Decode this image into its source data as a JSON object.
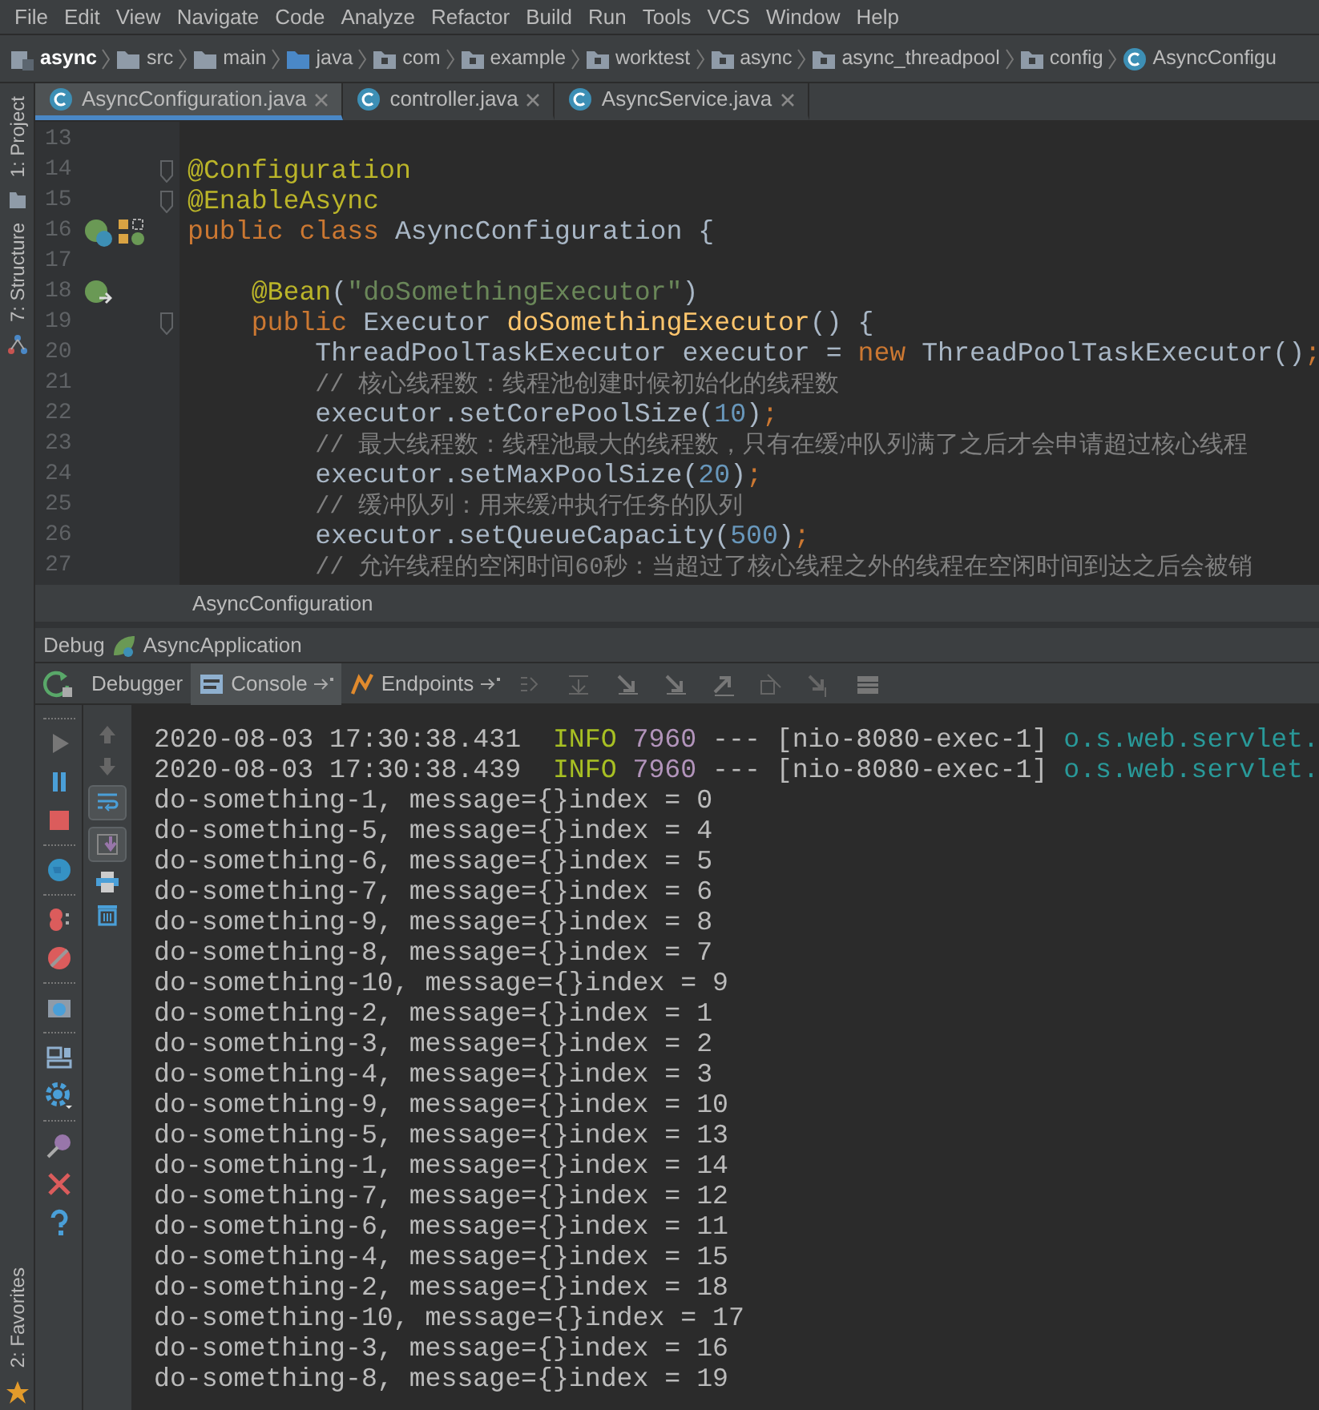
{
  "menu": [
    "File",
    "Edit",
    "View",
    "Navigate",
    "Code",
    "Analyze",
    "Refactor",
    "Build",
    "Run",
    "Tools",
    "VCS",
    "Window",
    "Help"
  ],
  "breadcrumb": [
    {
      "kind": "module",
      "label": "async"
    },
    {
      "kind": "folder",
      "label": "src"
    },
    {
      "kind": "folder",
      "label": "main"
    },
    {
      "kind": "source",
      "label": "java"
    },
    {
      "kind": "package",
      "label": "com"
    },
    {
      "kind": "package",
      "label": "example"
    },
    {
      "kind": "package",
      "label": "worktest"
    },
    {
      "kind": "package",
      "label": "async"
    },
    {
      "kind": "package",
      "label": "async_threadpool"
    },
    {
      "kind": "package",
      "label": "config"
    },
    {
      "kind": "class",
      "label": "AsyncConfigu"
    }
  ],
  "side_tools": {
    "top": [
      "1: Project",
      "7: Structure"
    ],
    "bottom": [
      "2: Favorites"
    ]
  },
  "editor_tabs": [
    {
      "label": "AsyncConfiguration.java",
      "selected": true
    },
    {
      "label": "controller.java",
      "selected": false
    },
    {
      "label": "AsyncService.java",
      "selected": false
    }
  ],
  "code_lines": [
    {
      "number": "13"
    },
    {
      "number": "14",
      "fold": true,
      "tokens": [
        {
          "kind": "annotation",
          "text": "@Configuration"
        }
      ]
    },
    {
      "number": "15",
      "fold": true,
      "tokens": [
        {
          "kind": "annotation",
          "text": "@EnableAsync"
        }
      ]
    },
    {
      "number": "16",
      "kind": "spring-class",
      "tokens": [
        {
          "kind": "keyword",
          "text": "public class "
        },
        {
          "kind": "plain",
          "text": "AsyncConfiguration {"
        }
      ]
    },
    {
      "number": "17"
    },
    {
      "number": "18",
      "kind": "spring-bean",
      "tokens": [
        {
          "kind": "annotation",
          "text": "    @Bean"
        },
        {
          "kind": "plain",
          "text": "("
        },
        {
          "kind": "string",
          "text": "\"doSomethingExecutor\""
        },
        {
          "kind": "plain",
          "text": ")"
        }
      ]
    },
    {
      "number": "19",
      "fold": true,
      "tokens": [
        {
          "kind": "keyword",
          "text": "    public "
        },
        {
          "kind": "plain",
          "text": "Executor "
        },
        {
          "kind": "method",
          "text": "doSomethingExecutor"
        },
        {
          "kind": "plain",
          "text": "() {"
        }
      ]
    },
    {
      "number": "20",
      "tokens": [
        {
          "kind": "plain",
          "text": "        ThreadPoolTaskExecutor executor = "
        },
        {
          "kind": "keyword",
          "text": "new "
        },
        {
          "kind": "plain",
          "text": "ThreadPoolTaskExecutor()"
        },
        {
          "kind": "keyword",
          "text": ";"
        }
      ]
    },
    {
      "number": "21",
      "tokens": [
        {
          "kind": "comment",
          "text": "        // 核心线程数：线程池创建时候初始化的线程数"
        }
      ]
    },
    {
      "number": "22",
      "tokens": [
        {
          "kind": "plain",
          "text": "        executor.setCorePoolSize("
        },
        {
          "kind": "number",
          "text": "10"
        },
        {
          "kind": "plain",
          "text": ")"
        },
        {
          "kind": "keyword",
          "text": ";"
        }
      ]
    },
    {
      "number": "23",
      "tokens": [
        {
          "kind": "comment",
          "text": "        // 最大线程数：线程池最大的线程数，只有在缓冲队列满了之后才会申请超过核心线程"
        }
      ]
    },
    {
      "number": "24",
      "tokens": [
        {
          "kind": "plain",
          "text": "        executor.setMaxPoolSize("
        },
        {
          "kind": "number",
          "text": "20"
        },
        {
          "kind": "plain",
          "text": ")"
        },
        {
          "kind": "keyword",
          "text": ";"
        }
      ]
    },
    {
      "number": "25",
      "tokens": [
        {
          "kind": "comment",
          "text": "        // 缓冲队列：用来缓冲执行任务的队列"
        }
      ]
    },
    {
      "number": "26",
      "tokens": [
        {
          "kind": "plain",
          "text": "        executor.setQueueCapacity("
        },
        {
          "kind": "number",
          "text": "500"
        },
        {
          "kind": "plain",
          "text": ")"
        },
        {
          "kind": "keyword",
          "text": ";"
        }
      ]
    },
    {
      "number": "27",
      "tokens": [
        {
          "kind": "comment",
          "text": "        // 允许线程的空闲时间60秒：当超过了核心线程之外的线程在空闲时间到达之后会被销"
        }
      ]
    }
  ],
  "editor_breadcrumb": "AsyncConfiguration",
  "debug": {
    "label": "Debug",
    "config": "AsyncApplication",
    "tabs": [
      {
        "label": "Debugger",
        "selected": false,
        "pinned": false
      },
      {
        "label": "Console",
        "selected": true,
        "pinned": true
      },
      {
        "label": "Endpoints",
        "selected": false,
        "pinned": true
      }
    ],
    "console_tools": [
      {
        "kind": "up"
      },
      {
        "kind": "down"
      },
      {
        "kind": "soft-wrap",
        "on": true
      },
      {
        "kind": "scroll-end",
        "on": true
      },
      {
        "kind": "print"
      },
      {
        "kind": "trash"
      }
    ],
    "console_lines": [
      [
        {
          "kind": "plain",
          "text": "2020-08-03 17:30:38.431  "
        },
        {
          "kind": "info",
          "text": "INFO"
        },
        {
          "kind": "pid",
          "text": "7960"
        },
        {
          "kind": "plain",
          "text": " --- [nio-8080-exec-1] "
        },
        {
          "kind": "logger",
          "text": "o.s.web.servlet."
        }
      ],
      [
        {
          "kind": "plain",
          "text": "2020-08-03 17:30:38.439  "
        },
        {
          "kind": "info",
          "text": "INFO"
        },
        {
          "kind": "pid",
          "text": "7960"
        },
        {
          "kind": "plain",
          "text": " --- [nio-8080-exec-1] "
        },
        {
          "kind": "logger",
          "text": "o.s.web.servlet."
        }
      ],
      [
        {
          "kind": "plain",
          "text": "do-something-1, message={}index = 0"
        }
      ],
      [
        {
          "kind": "plain",
          "text": "do-something-5, message={}index = 4"
        }
      ],
      [
        {
          "kind": "plain",
          "text": "do-something-6, message={}index = 5"
        }
      ],
      [
        {
          "kind": "plain",
          "text": "do-something-7, message={}index = 6"
        }
      ],
      [
        {
          "kind": "plain",
          "text": "do-something-9, message={}index = 8"
        }
      ],
      [
        {
          "kind": "plain",
          "text": "do-something-8, message={}index = 7"
        }
      ],
      [
        {
          "kind": "plain",
          "text": "do-something-10, message={}index = 9"
        }
      ],
      [
        {
          "kind": "plain",
          "text": "do-something-2, message={}index = 1"
        }
      ],
      [
        {
          "kind": "plain",
          "text": "do-something-3, message={}index = 2"
        }
      ],
      [
        {
          "kind": "plain",
          "text": "do-something-4, message={}index = 3"
        }
      ],
      [
        {
          "kind": "plain",
          "text": "do-something-9, message={}index = 10"
        }
      ],
      [
        {
          "kind": "plain",
          "text": "do-something-5, message={}index = 13"
        }
      ],
      [
        {
          "kind": "plain",
          "text": "do-something-1, message={}index = 14"
        }
      ],
      [
        {
          "kind": "plain",
          "text": "do-something-7, message={}index = 12"
        }
      ],
      [
        {
          "kind": "plain",
          "text": "do-something-6, message={}index = 11"
        }
      ],
      [
        {
          "kind": "plain",
          "text": "do-something-4, message={}index = 15"
        }
      ],
      [
        {
          "kind": "plain",
          "text": "do-something-2, message={}index = 18"
        }
      ],
      [
        {
          "kind": "plain",
          "text": "do-something-10, message={}index = 17"
        }
      ],
      [
        {
          "kind": "plain",
          "text": "do-something-3, message={}index = 16"
        }
      ],
      [
        {
          "kind": "plain",
          "text": "do-something-8, message={}index = 19"
        }
      ]
    ]
  }
}
